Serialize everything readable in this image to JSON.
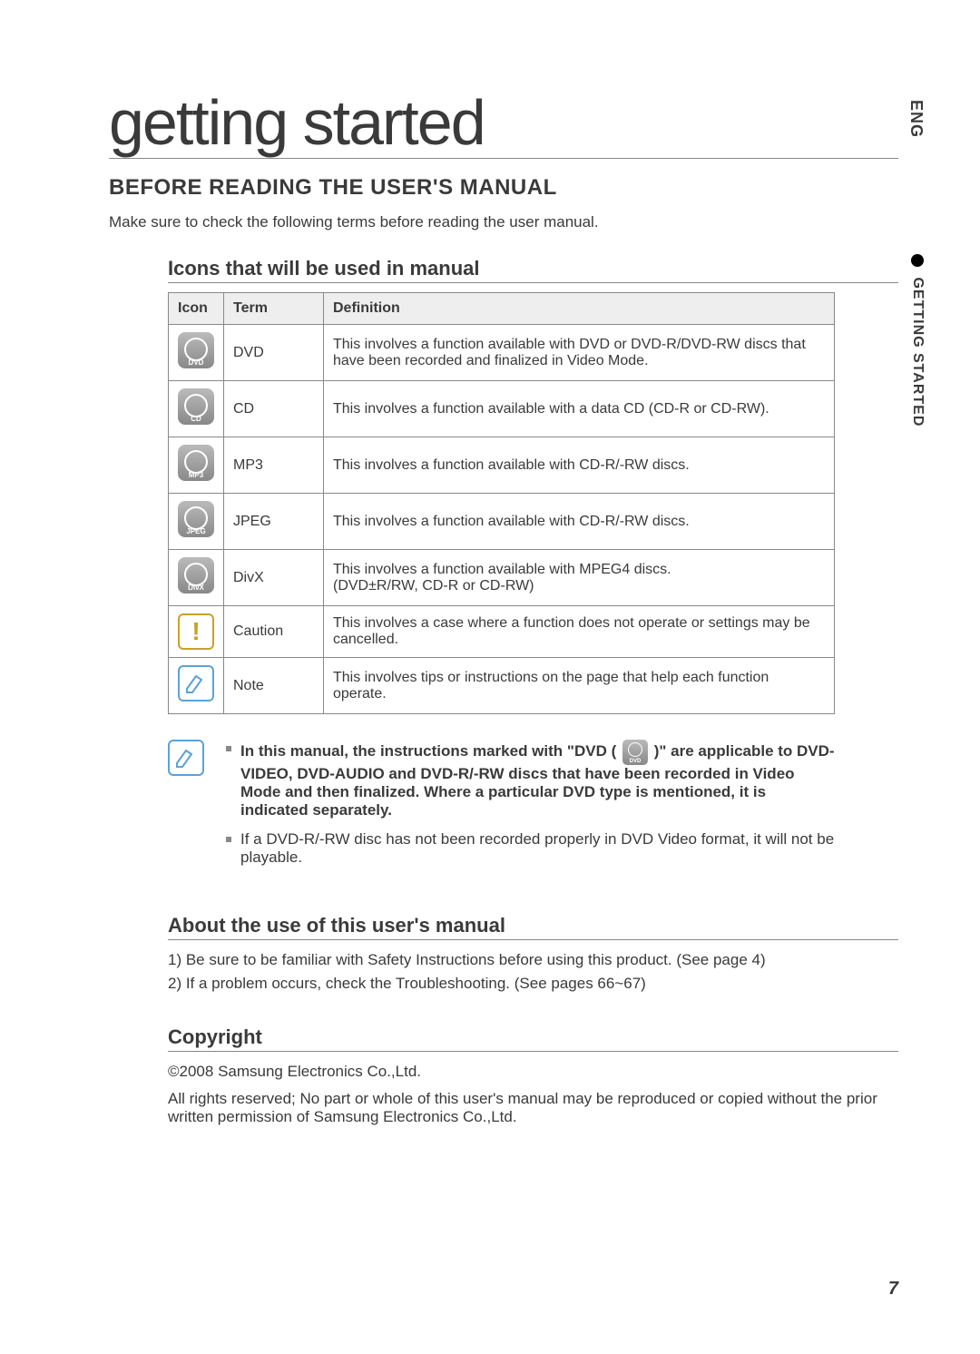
{
  "lang_tab": "ENG",
  "side_tab": "GETTING STARTED",
  "title": "getting started",
  "h2": "BEFORE READING THE USER'S MANUAL",
  "intro": "Make sure to check the following terms before reading the user manual.",
  "icons_heading": "Icons that will be used in manual",
  "table": {
    "headers": {
      "icon": "Icon",
      "term": "Term",
      "definition": "Definition"
    },
    "rows": [
      {
        "icon_label": "DVD",
        "term": "DVD",
        "definition": "This involves a function available with DVD or DVD-R/DVD-RW discs that have been recorded and finalized in Video Mode."
      },
      {
        "icon_label": "CD",
        "term": "CD",
        "definition": "This involves a function available with a data CD (CD-R or CD-RW)."
      },
      {
        "icon_label": "MP3",
        "term": "MP3",
        "definition": "This involves a function available with CD-R/-RW discs."
      },
      {
        "icon_label": "JPEG",
        "term": "JPEG",
        "definition": "This involves a function available with CD-R/-RW discs."
      },
      {
        "icon_label": "DivX",
        "term": "DivX",
        "definition": "This involves a function available with MPEG4 discs.\n(DVD±R/RW, CD-R or CD-RW)"
      },
      {
        "icon_label": "!",
        "term": "Caution",
        "definition": "This involves a case where a function does not operate or settings may be cancelled."
      },
      {
        "icon_label": "note",
        "term": "Note",
        "definition": "This involves tips or instructions on the page that help each function operate."
      }
    ]
  },
  "notes": {
    "line1_a": "In this manual, the instructions marked with \"DVD (",
    "line1_inline_label": "DVD",
    "line1_b": ")\" are applicable to DVD-VIDEO, DVD-AUDIO and DVD-R/-RW discs that have been recorded in Video Mode and then finalized. Where a particular DVD type is mentioned, it is indicated separately.",
    "line2": "If a DVD-R/-RW disc has not been recorded properly in DVD Video format, it will not be playable."
  },
  "about_heading": "About the use of this user's manual",
  "about_list": [
    "1)  Be sure to be familiar with Safety Instructions before using this product. (See page 4)",
    "2)  If a problem occurs, check the Troubleshooting. (See pages 66~67)"
  ],
  "copyright_heading": "Copyright",
  "copyright_body": [
    "©2008 Samsung Electronics Co.,Ltd.",
    "All rights reserved; No part or whole of this user's manual may be reproduced or copied without the prior written permission of Samsung Electronics Co.,Ltd."
  ],
  "page_number": "7"
}
